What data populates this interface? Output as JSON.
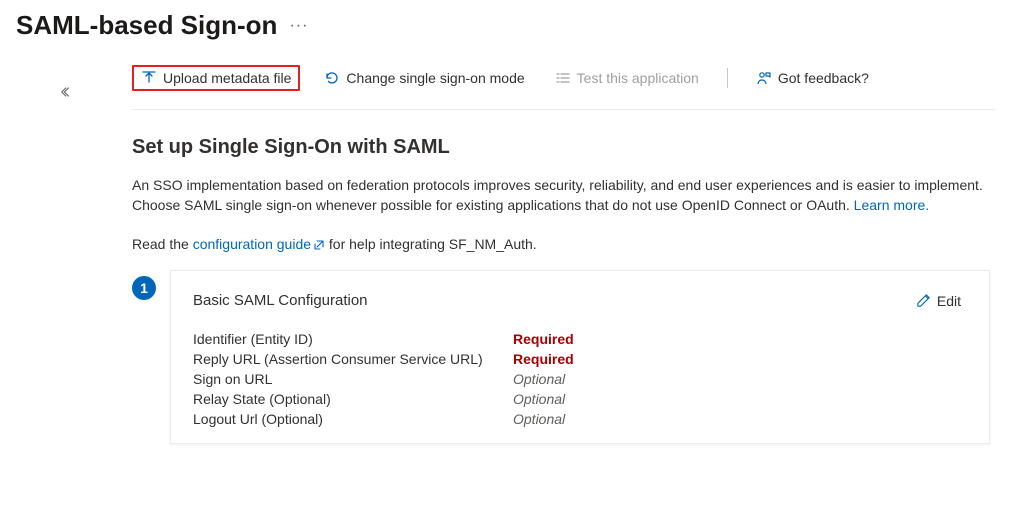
{
  "header": {
    "title": "SAML-based Sign-on"
  },
  "toolbar": {
    "upload_label": "Upload metadata file",
    "change_mode_label": "Change single sign-on mode",
    "test_label": "Test this application",
    "feedback_label": "Got feedback?"
  },
  "main": {
    "heading": "Set up Single Sign-On with SAML",
    "description": "An SSO implementation based on federation protocols improves security, reliability, and end user experiences and is easier to implement. Choose SAML single sign-on whenever possible for existing applications that do not use OpenID Connect or OAuth. ",
    "learn_more": "Learn more.",
    "guide_prefix": "Read the ",
    "guide_link": "configuration guide",
    "guide_suffix": " for help integrating SF_NM_Auth."
  },
  "card": {
    "step": "1",
    "title": "Basic SAML Configuration",
    "edit_label": "Edit",
    "rows": [
      {
        "label": "Identifier (Entity ID)",
        "value": "Required",
        "kind": "required"
      },
      {
        "label": "Reply URL (Assertion Consumer Service URL)",
        "value": "Required",
        "kind": "required"
      },
      {
        "label": "Sign on URL",
        "value": "Optional",
        "kind": "optional"
      },
      {
        "label": "Relay State (Optional)",
        "value": "Optional",
        "kind": "optional"
      },
      {
        "label": "Logout Url (Optional)",
        "value": "Optional",
        "kind": "optional"
      }
    ]
  }
}
